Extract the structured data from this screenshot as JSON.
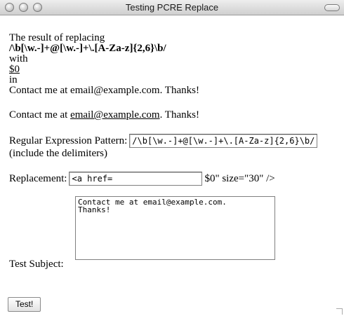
{
  "window": {
    "title": "Testing PCRE Replace"
  },
  "result": {
    "intro": "The result of replacing",
    "pattern": "/\\b[\\w.-]+@[\\w.-]+\\.[A-Za-z]{2,6}\\b/",
    "with_label": "with",
    "replacement_link": "$0",
    "in_label": "in",
    "subject": "Contact me at email@example.com. Thanks!",
    "output_before": "Contact me at ",
    "output_link": "email@example.com",
    "output_after": ". Thanks!"
  },
  "form": {
    "pattern_label": "Regular Expression Pattern:",
    "pattern_value": "/\\b[\\w.-]+@[\\w.-]+\\.[A-Za-z]{2,6}\\b/",
    "pattern_note": "(include the delimiters)",
    "replacement_label": "Replacement:",
    "replacement_value": "<a href=",
    "replacement_trailing": "$0\" size=\"30\" />",
    "subject_label": "Test Subject:",
    "subject_value": "Contact me at email@example.com.\nThanks!",
    "submit_label": "Test!"
  }
}
